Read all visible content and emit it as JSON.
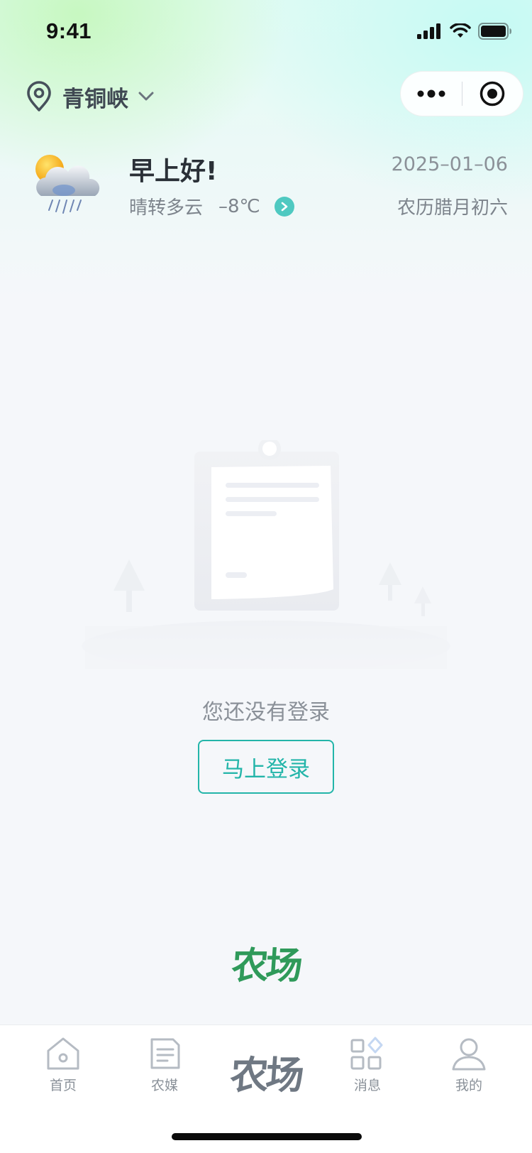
{
  "status_bar": {
    "time": "9:41"
  },
  "header": {
    "location": "青铜峡",
    "icons": {
      "location": "location-pin-icon",
      "dropdown": "chevron-down-icon",
      "more": "more-dots-icon",
      "close": "target-close-icon"
    }
  },
  "weather": {
    "greeting": "早上好!",
    "condition": "晴转多云",
    "temperature": "–8℃",
    "date": "2025–01–06",
    "lunar_date": "农历腊月初六",
    "icon": "sun-cloud-rain-icon"
  },
  "main": {
    "empty_message": "您还没有登录",
    "login_button": "马上登录",
    "brand": "农场"
  },
  "tab_bar": {
    "items": [
      {
        "label": "首页",
        "icon": "home-icon"
      },
      {
        "label": "农媒",
        "icon": "document-icon"
      },
      {
        "label": "农场",
        "icon": "brand-logo"
      },
      {
        "label": "消息",
        "icon": "grid-icon"
      },
      {
        "label": "我的",
        "icon": "user-icon"
      }
    ]
  },
  "colors": {
    "accent": "#23b5a9",
    "brand_green": "#2f9a5a",
    "text_dark": "#2a3037",
    "text_muted": "#8a9098"
  }
}
